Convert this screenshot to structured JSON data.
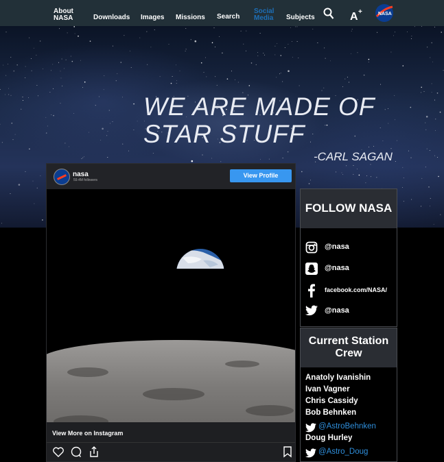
{
  "nav": {
    "items": [
      {
        "label_line1": "About",
        "label_line2": "NASA"
      },
      {
        "label": "Downloads"
      },
      {
        "label": "Images"
      },
      {
        "label": "Missions"
      },
      {
        "label": "Search"
      },
      {
        "label_line1": "Social",
        "label_line2": "Media",
        "active": true
      },
      {
        "label": "Subjects"
      }
    ],
    "icons": [
      "search-icon",
      "text-size-icon",
      "nasa-logo"
    ],
    "accent_color": "#1d6fb8"
  },
  "hero": {
    "quote_line1": "WE ARE MADE OF",
    "quote_line2": "STAR STUFF",
    "author": "-CARL SAGAN"
  },
  "instagram": {
    "username": "nasa",
    "followers": "59.4M followers",
    "view_profile_label": "View Profile",
    "view_more_label": "View More on Instagram",
    "button_color": "#3897f0",
    "actions": [
      "heart-icon",
      "comment-icon",
      "share-icon",
      "bookmark-icon"
    ]
  },
  "follow": {
    "title": "FOLLOW NASA",
    "items": [
      {
        "icon": "instagram-icon",
        "label": "@nasa"
      },
      {
        "icon": "snapchat-icon",
        "label": "@nasa"
      },
      {
        "icon": "facebook-icon",
        "label": "facebook.com/NASA/"
      },
      {
        "icon": "twitter-icon",
        "label": "@nasa"
      }
    ]
  },
  "crew": {
    "title_line1": "Current Station",
    "title_line2": "Crew",
    "members": [
      {
        "name": "Anatoly Ivanishin"
      },
      {
        "name": "Ivan Vagner"
      },
      {
        "name": "Chris Cassidy"
      },
      {
        "name": "Bob Behnken",
        "handle": "@AstroBehnken"
      },
      {
        "name": "Doug Hurley",
        "handle": "@Astro_Doug"
      }
    ],
    "handle_color": "#2f8fdc"
  }
}
